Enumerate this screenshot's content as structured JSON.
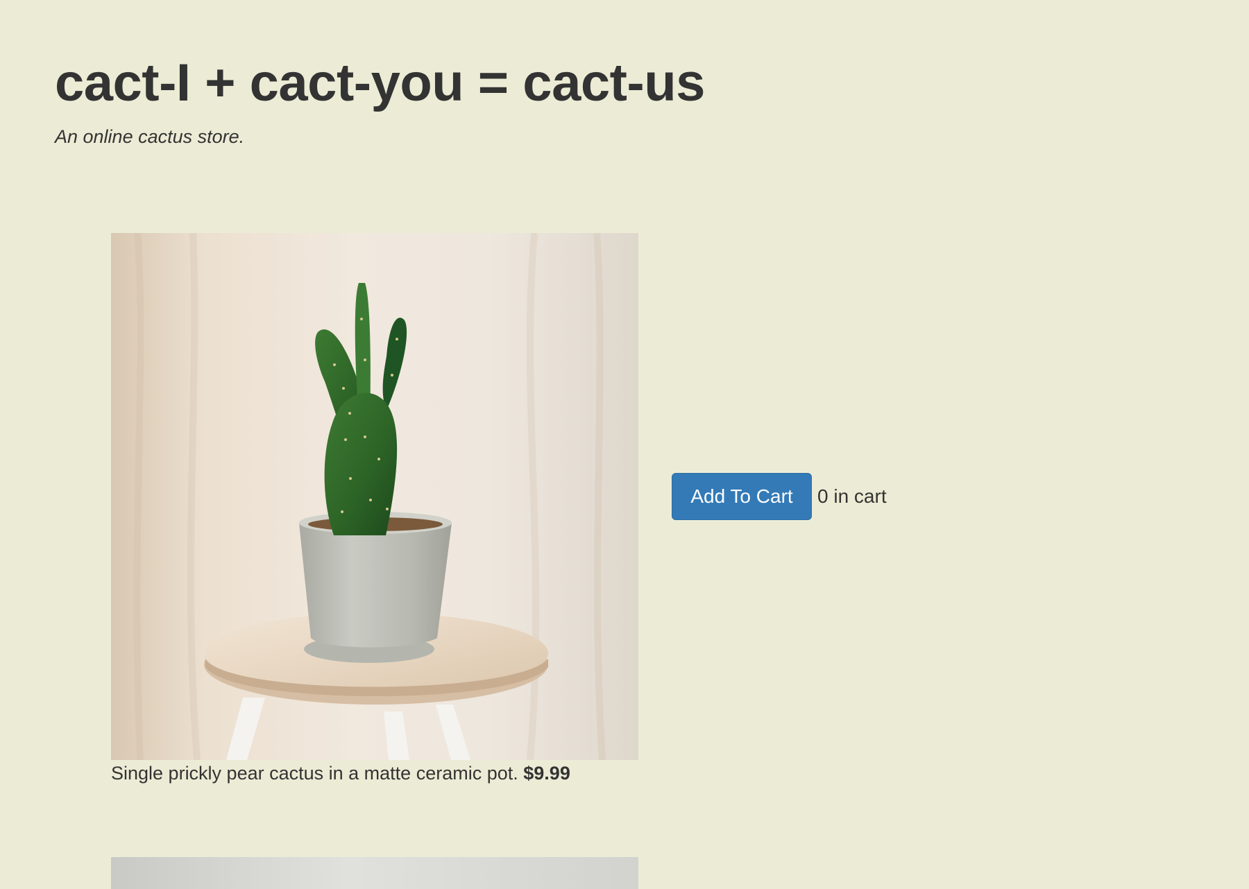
{
  "header": {
    "title": "cact-I + cact-you = cact-us",
    "subtitle": "An online cactus store."
  },
  "product": {
    "description": "Single prickly pear cactus in a matte ceramic pot.",
    "price": "$9.99",
    "add_to_cart_label": "Add To Cart",
    "cart_count": "0 in cart",
    "image_subject": "prickly pear cactus in grey ceramic pot on wooden stool"
  },
  "next_product": {
    "image_subject": "partially visible product photo"
  },
  "colors": {
    "background": "#ececd6",
    "text": "#333333",
    "button": "#337ab7",
    "button_text": "#ffffff"
  }
}
